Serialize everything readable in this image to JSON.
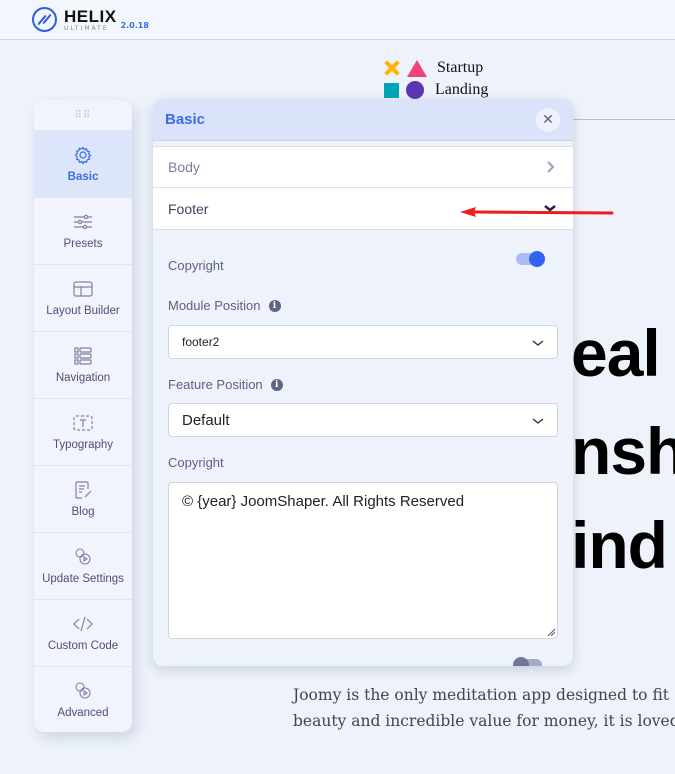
{
  "app": {
    "name": "HELIX",
    "subtitle": "ULTIMATE",
    "version": "2.0.18"
  },
  "legend": [
    {
      "icons": [
        "x-mark",
        "triangle"
      ],
      "label": "Startup"
    },
    {
      "icons": [
        "square",
        "circle"
      ],
      "label": "Landing"
    }
  ],
  "hero": {
    "lines": [
      "eal",
      "nsh",
      "ind"
    ]
  },
  "description": {
    "lines": [
      "Joomy is the only meditation app designed to fit",
      "beauty and incredible value for money, it is loved"
    ]
  },
  "sidebar": {
    "items": [
      {
        "label": "Basic",
        "icon": "gear-icon",
        "active": true
      },
      {
        "label": "Presets",
        "icon": "sliders-icon"
      },
      {
        "label": "Layout Builder",
        "icon": "layout-icon"
      },
      {
        "label": "Navigation",
        "icon": "list-icon"
      },
      {
        "label": "Typography",
        "icon": "text-icon"
      },
      {
        "label": "Blog",
        "icon": "edit-document-icon"
      },
      {
        "label": "Update Settings",
        "icon": "settings-cogs-icon"
      },
      {
        "label": "Custom Code",
        "icon": "code-icon"
      },
      {
        "label": "Advanced",
        "icon": "advanced-cogs-icon"
      }
    ]
  },
  "panel": {
    "title": "Basic",
    "close_label": "✕",
    "sections": [
      {
        "label": "Body",
        "expanded": false
      },
      {
        "label": "Footer",
        "expanded": true
      }
    ],
    "footer": {
      "copyright_toggle_label": "Copyright",
      "copyright_enabled": true,
      "module_position_label": "Module Position",
      "module_position_value": "footer2",
      "feature_position_label": "Feature Position",
      "feature_position_value": "Default",
      "copyright_text_label": "Copyright",
      "copyright_text_value": "© {year} JoomShaper. All Rights Reserved",
      "next_toggle_enabled": false
    }
  },
  "colors": {
    "accent": "#3b6de0",
    "annotation_arrow": "#ee1c1c"
  }
}
